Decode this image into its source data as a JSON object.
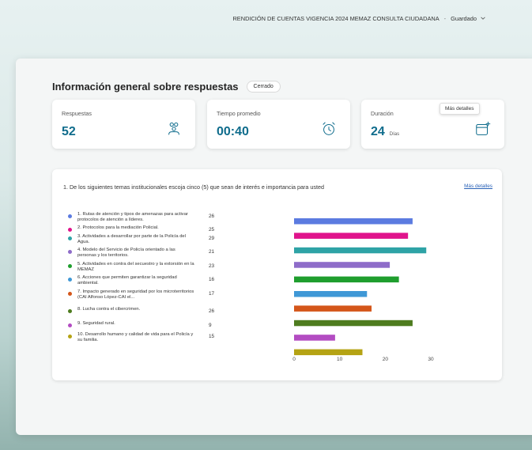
{
  "header": {
    "form_title": "RENDICIÓN DE CUENTAS VIGENCIA 2024 MEMAZ CONSULTA CIUDADANA",
    "separator": "-",
    "save_status": "Guardado"
  },
  "overview": {
    "title": "Información general sobre respuestas",
    "state_badge": "Cerrado",
    "cards": [
      {
        "label": "Respuestas",
        "value": "52",
        "unit": "",
        "icon": "people-icon"
      },
      {
        "label": "Tiempo promedio",
        "value": "00:40",
        "unit": "",
        "icon": "alarm-clock-icon"
      },
      {
        "label": "Duración",
        "value": "24",
        "unit": "Días",
        "icon": "calendar-add-icon"
      }
    ]
  },
  "question": {
    "title": "1. De los siguientes temas institucionales escoja cinco (5) que sean de interés e importancia para usted",
    "more_details_link": "Más detalles",
    "tooltip": "Más detalles"
  },
  "chart_data": {
    "type": "bar",
    "orientation": "horizontal",
    "categories": [
      "1. Rutas de atención y tipos de amenazas para activar protocolos de atención a líderes.",
      "2. Protocolos para la mediación Policial.",
      "3. Actividades a desarrollar por parte de la Policía del Agua.",
      "4. Modelo del Servicio de Policía orientado a las personas y los territorios.",
      "5. Actividades en contra del secuestro y la extorsión en la MEMAZ",
      "6. Acciones que permiten garantizar la seguridad ambiental.",
      "7. Impacto generado en seguridad por los microterritorios (CAI Alfonso López-CAI el...",
      "8. Lucha contra el cibercrimen.",
      "9. Seguridad rural.",
      "10. Desarrollo humano y calidad de vida para el Policía y su familia."
    ],
    "values": [
      26,
      25,
      29,
      21,
      23,
      16,
      17,
      26,
      9,
      15
    ],
    "colors": [
      "#5b7be0",
      "#e0148c",
      "#2ea3a6",
      "#8e6cc9",
      "#1f9e2e",
      "#3f98d6",
      "#d4561a",
      "#4e7c1f",
      "#b34cc2",
      "#b5a314"
    ],
    "xlim": [
      0,
      30
    ],
    "xticks": [
      0,
      10,
      20,
      30
    ],
    "grid": false,
    "legend": "left"
  }
}
